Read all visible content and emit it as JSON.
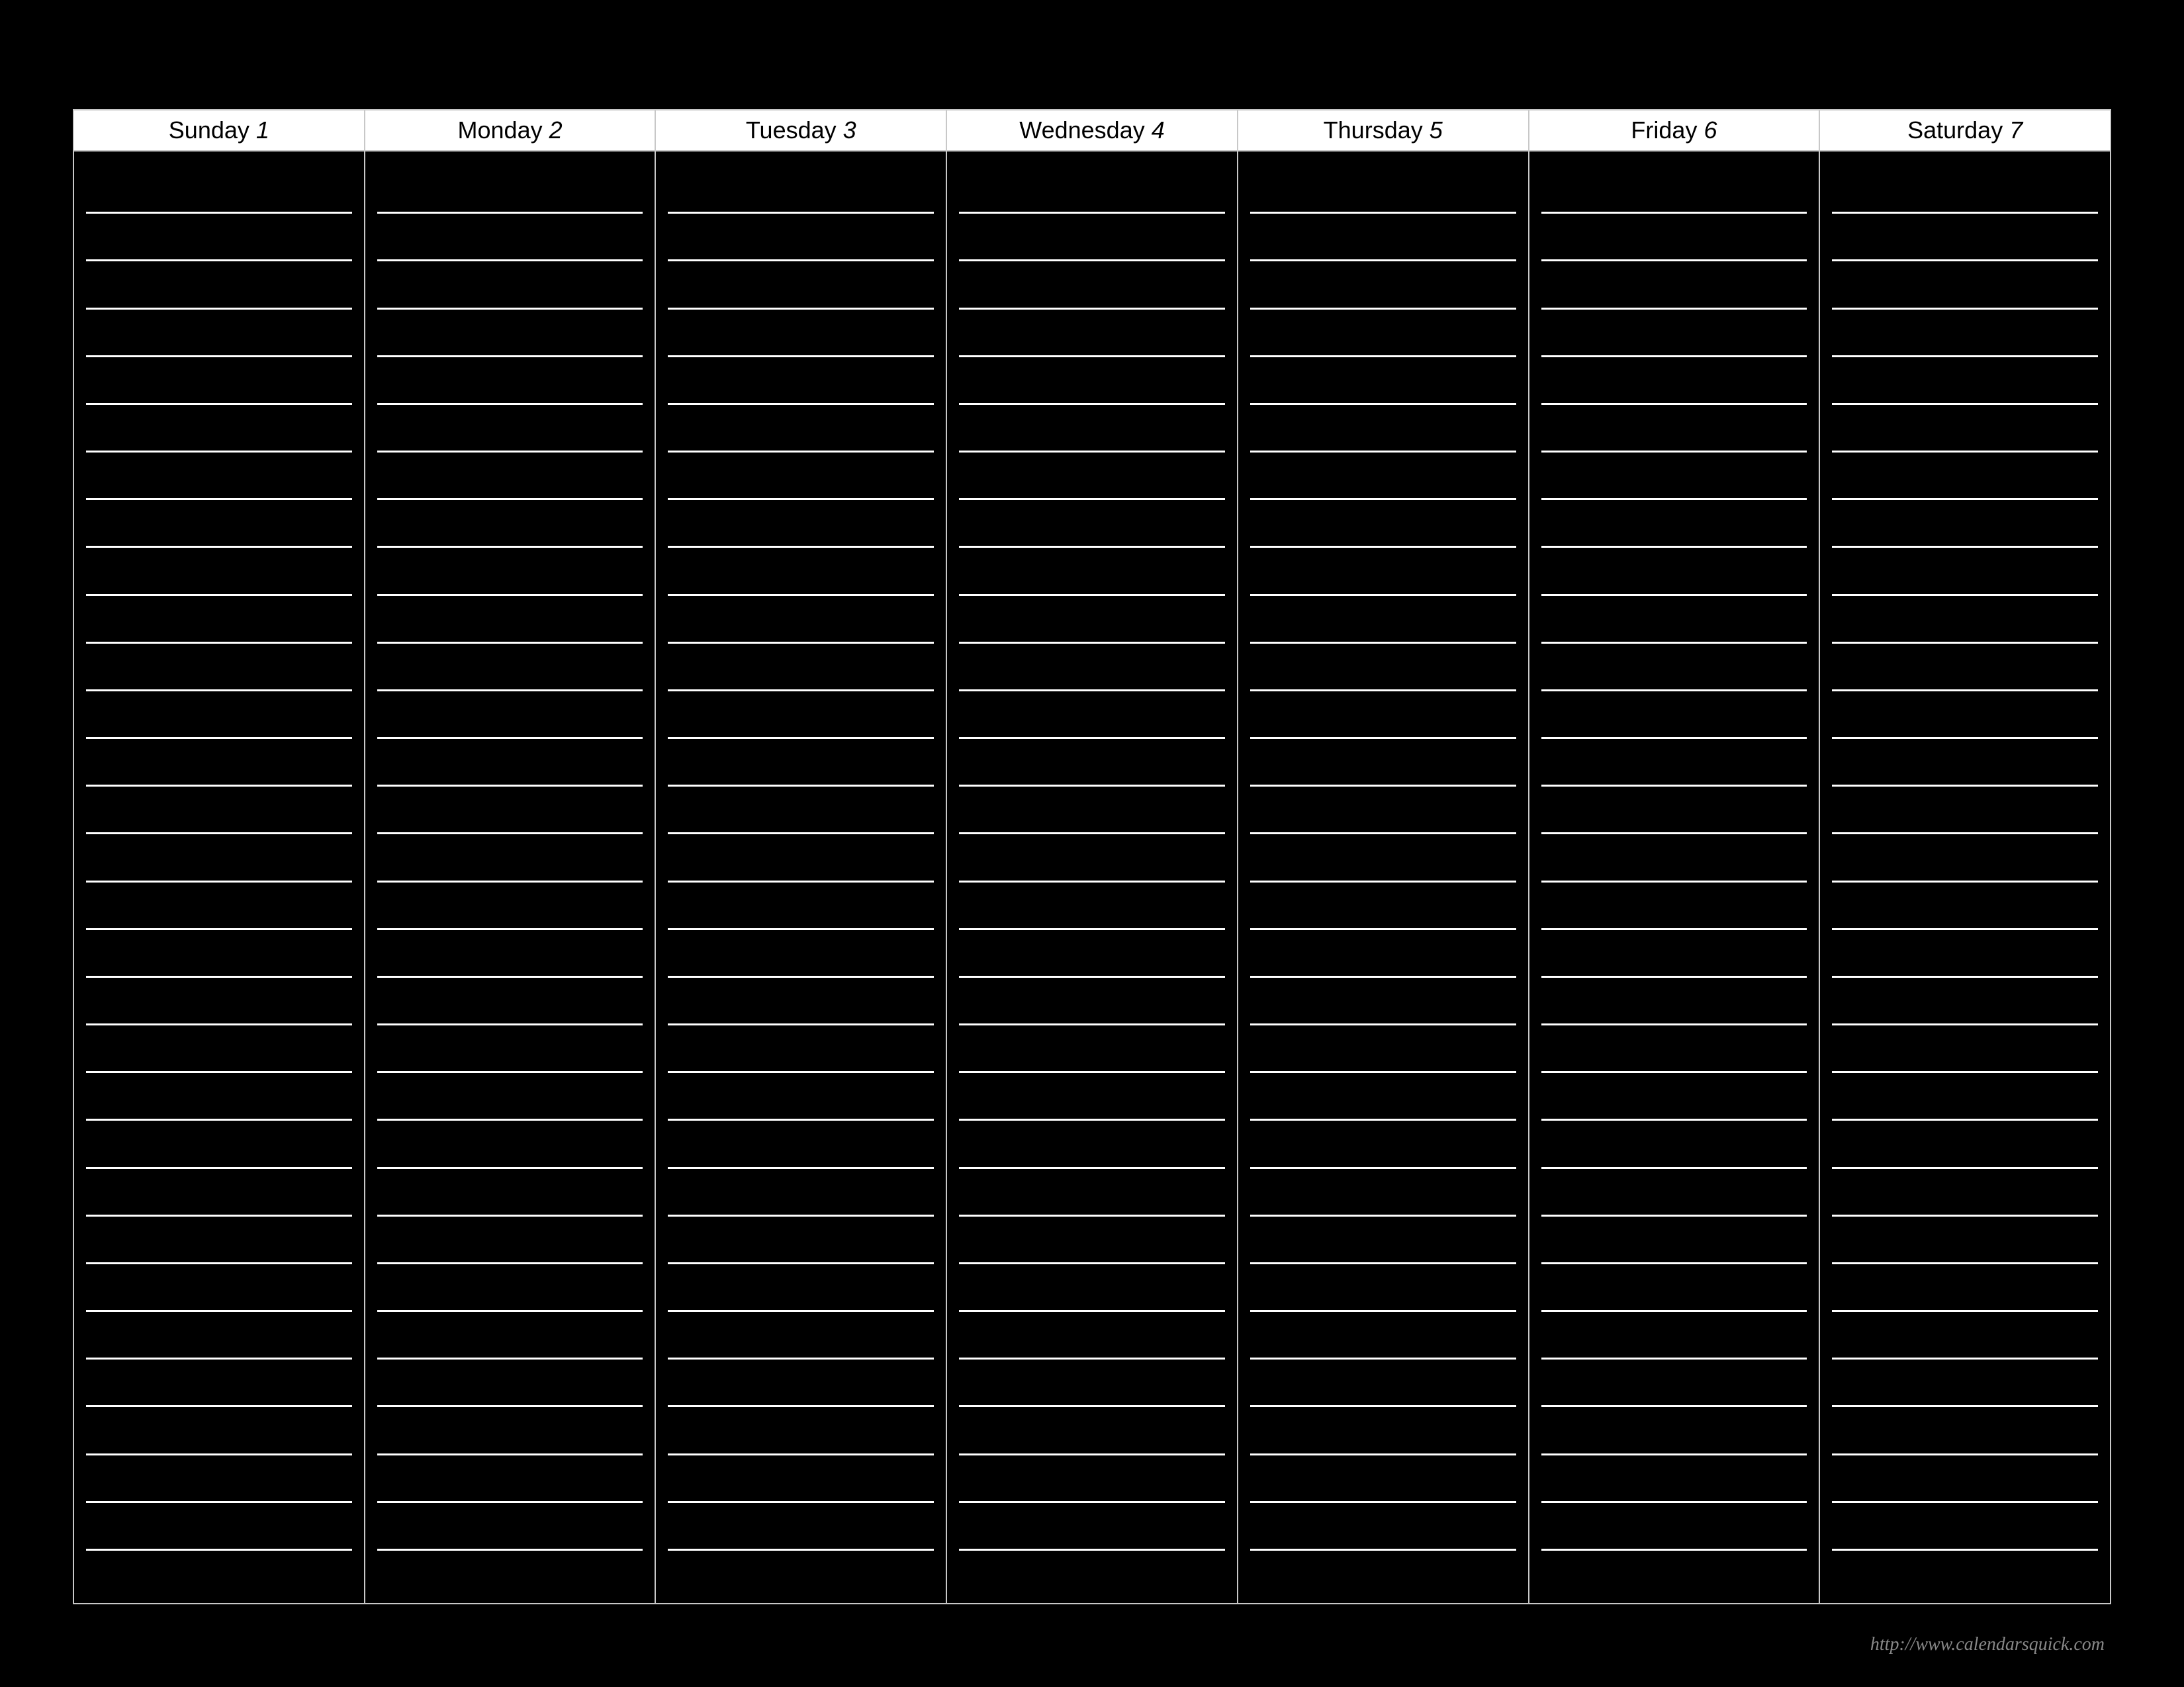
{
  "calendar": {
    "lines_per_day": 30,
    "days": [
      {
        "name": "Sunday",
        "number": "1"
      },
      {
        "name": "Monday",
        "number": "2"
      },
      {
        "name": "Tuesday",
        "number": "3"
      },
      {
        "name": "Wednesday",
        "number": "4"
      },
      {
        "name": "Thursday",
        "number": "5"
      },
      {
        "name": "Friday",
        "number": "6"
      },
      {
        "name": "Saturday",
        "number": "7"
      }
    ]
  },
  "footer": {
    "url_text": "http://www.calendarsquick.com"
  },
  "colors": {
    "background": "#000000",
    "header_bg": "#ffffff",
    "header_text": "#000000",
    "grid_border": "#c8c8c8",
    "rule_line": "#ffffff",
    "footer_text": "#888888"
  }
}
